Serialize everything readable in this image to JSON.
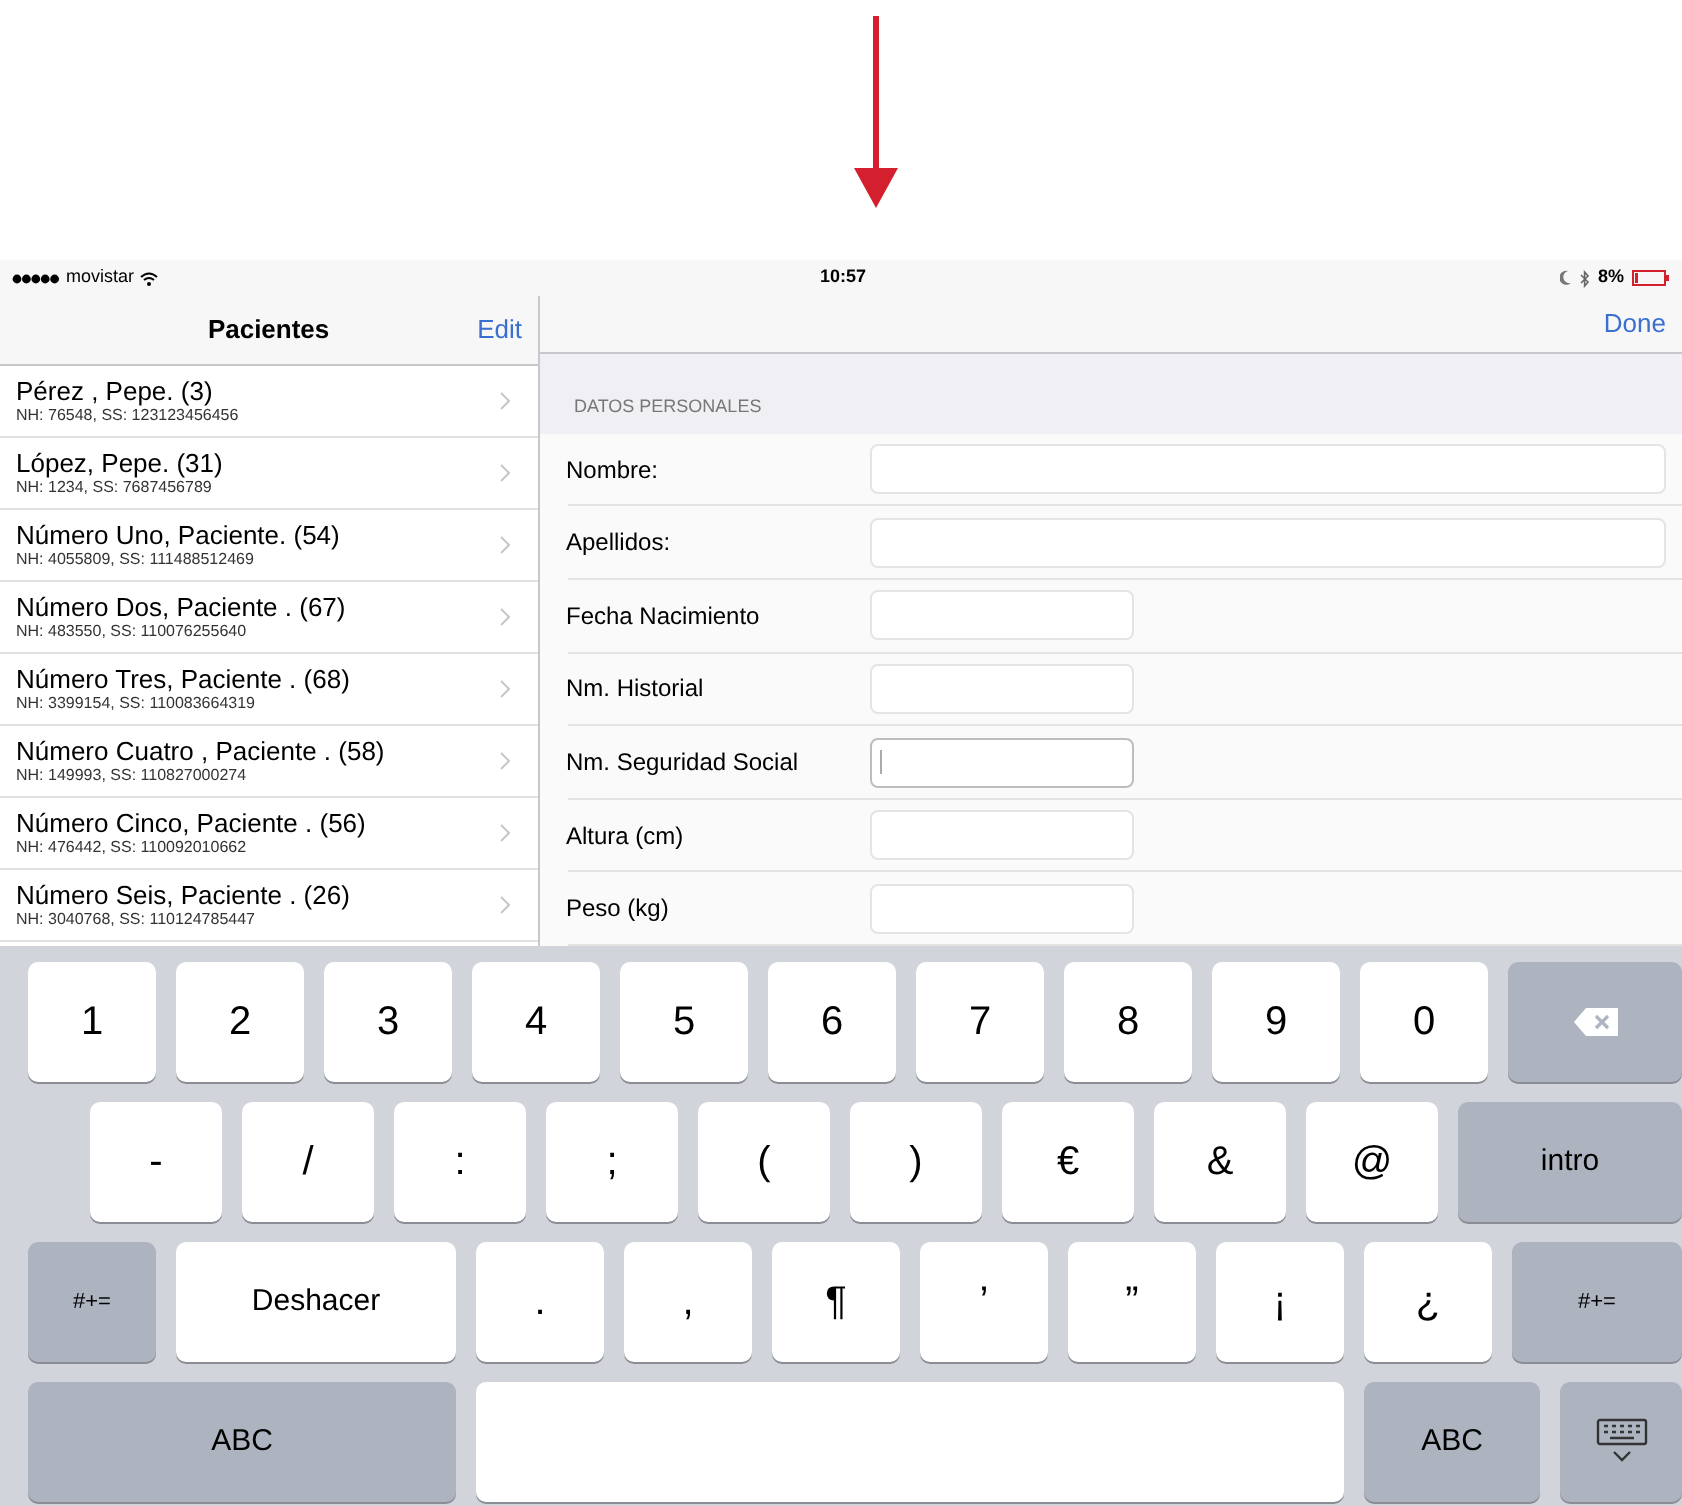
{
  "status_bar": {
    "carrier": "movistar",
    "time": "10:57",
    "battery": "8%"
  },
  "master": {
    "title": "Pacientes",
    "edit": "Edit",
    "patients": [
      {
        "name": "Pérez , Pepe. (3)",
        "detail": "NH: 76548, SS: 123123456456"
      },
      {
        "name": "López, Pepe. (31)",
        "detail": "NH: 1234, SS: 7687456789"
      },
      {
        "name": "Número Uno, Paciente. (54)",
        "detail": "NH: 4055809, SS: 111488512469"
      },
      {
        "name": "Número Dos, Paciente . (67)",
        "detail": "NH: 483550, SS: 110076255640"
      },
      {
        "name": "Número Tres, Paciente . (68)",
        "detail": "NH: 3399154, SS: 110083664319"
      },
      {
        "name": "Número Cuatro , Paciente . (58)",
        "detail": "NH: 149993, SS: 110827000274"
      },
      {
        "name": "Número Cinco, Paciente . (56)",
        "detail": "NH: 476442, SS: 110092010662"
      },
      {
        "name": "Número Seis, Paciente . (26)",
        "detail": "NH: 3040768, SS: 110124785447"
      }
    ]
  },
  "detail": {
    "done": "Done",
    "section": "DATOS PERSONALES",
    "fields": [
      {
        "label": "Nombre:",
        "kind": "wide",
        "focused": false
      },
      {
        "label": "Apellidos:",
        "kind": "wide",
        "focused": false
      },
      {
        "label": "Fecha Nacimiento",
        "kind": "narrow",
        "focused": false
      },
      {
        "label": "Nm. Historial",
        "kind": "narrow",
        "focused": false
      },
      {
        "label": "Nm. Seguridad Social",
        "kind": "narrow",
        "focused": true
      },
      {
        "label": "Altura (cm)",
        "kind": "narrow",
        "focused": false
      },
      {
        "label": "Peso (kg)",
        "kind": "narrow",
        "focused": false
      }
    ]
  },
  "keyboard": {
    "rows": [
      [
        {
          "label": "1",
          "kind": "char"
        },
        {
          "label": "2",
          "kind": "char"
        },
        {
          "label": "3",
          "kind": "char"
        },
        {
          "label": "4",
          "kind": "char"
        },
        {
          "label": "5",
          "kind": "char"
        },
        {
          "label": "6",
          "kind": "char"
        },
        {
          "label": "7",
          "kind": "char"
        },
        {
          "label": "8",
          "kind": "char"
        },
        {
          "label": "9",
          "kind": "char"
        },
        {
          "label": "0",
          "kind": "char"
        },
        {
          "kind": "delete"
        }
      ],
      [
        {
          "label": "-",
          "kind": "char"
        },
        {
          "label": "/",
          "kind": "char"
        },
        {
          "label": ":",
          "kind": "char"
        },
        {
          "label": ";",
          "kind": "char"
        },
        {
          "label": "(",
          "kind": "char"
        },
        {
          "label": ")",
          "kind": "char"
        },
        {
          "label": "€",
          "kind": "char"
        },
        {
          "label": "&",
          "kind": "char"
        },
        {
          "label": "@",
          "kind": "char"
        },
        {
          "label": "intro",
          "kind": "return"
        }
      ],
      [
        {
          "label": "#+=",
          "kind": "symbols"
        },
        {
          "label": "Deshacer",
          "kind": "undo"
        },
        {
          "label": ".",
          "kind": "char"
        },
        {
          "label": ",",
          "kind": "char"
        },
        {
          "label": "¶",
          "kind": "char"
        },
        {
          "label": "’",
          "kind": "char"
        },
        {
          "label": "”",
          "kind": "char"
        },
        {
          "label": "¡",
          "kind": "char"
        },
        {
          "label": "¿",
          "kind": "char"
        },
        {
          "label": "#+=",
          "kind": "symbols_end"
        }
      ],
      [
        {
          "label": "ABC",
          "kind": "abc"
        },
        {
          "kind": "space"
        },
        {
          "label": "ABC",
          "kind": "abc_small"
        },
        {
          "kind": "hide"
        }
      ]
    ]
  }
}
